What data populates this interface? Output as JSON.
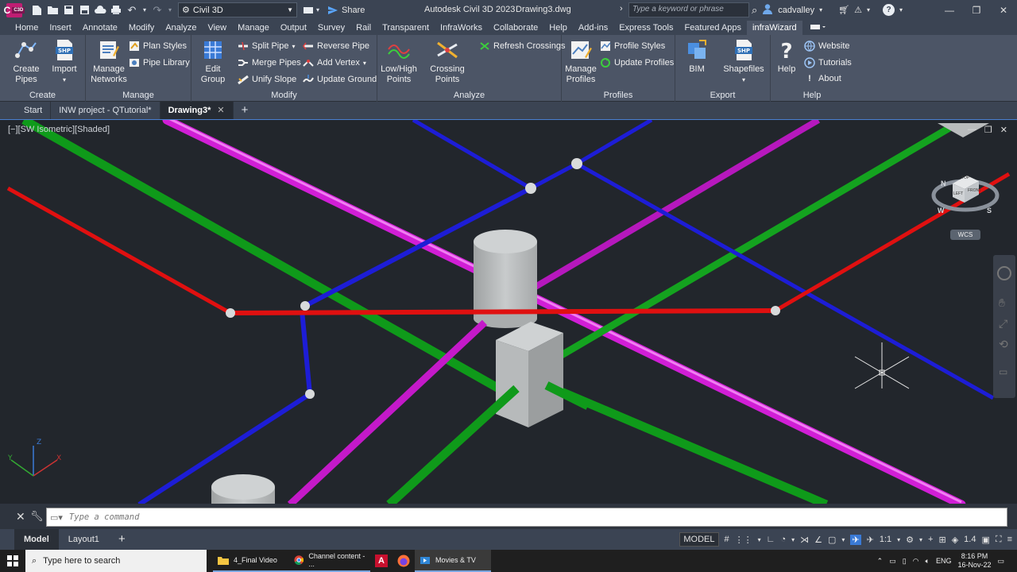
{
  "titlebar": {
    "logo_text": "C",
    "logo_sub": "C3D",
    "workspace": "Civil 3D",
    "share_label": "Share",
    "app_title": "Autodesk Civil 3D 2023",
    "document": "Drawing3.dwg",
    "search_placeholder": "Type a keyword or phrase",
    "user": "cadvalley"
  },
  "ribbon_tabs": [
    "Home",
    "Insert",
    "Annotate",
    "Modify",
    "Analyze",
    "View",
    "Manage",
    "Output",
    "Survey",
    "Rail",
    "Transparent",
    "InfraWorks",
    "Collaborate",
    "Help",
    "Add-ins",
    "Express Tools",
    "Featured Apps",
    "infraWizard"
  ],
  "ribbon": {
    "create": {
      "title": "Create",
      "create_pipes": "Create\nPipes",
      "import": "Import"
    },
    "manage": {
      "title": "Manage",
      "manage_networks": "Manage\nNetworks",
      "plan_styles": "Plan Styles",
      "pipe_library": "Pipe Library"
    },
    "modify": {
      "title": "Modify",
      "edit_group": "Edit Group",
      "split_pipe": "Split Pipe",
      "merge_pipes": "Merge Pipes",
      "unify_slope": "Unify Slope",
      "reverse_pipe": "Reverse Pipe",
      "add_vertex": "Add Vertex",
      "update_ground": "Update Ground"
    },
    "analyze": {
      "title": "Analyze",
      "low_high": "Low/High\nPoints",
      "crossing_points": "Crossing Points",
      "refresh_crossings": "Refresh Crossings"
    },
    "profiles": {
      "title": "Profiles",
      "manage_profiles": "Manage\nProfiles",
      "profile_styles": "Profile Styles",
      "update_profiles": "Update Profiles"
    },
    "export": {
      "title": "Export",
      "bim": "BIM",
      "shapefiles": "Shapefiles"
    },
    "help": {
      "title": "Help",
      "help": "Help",
      "website": "Website",
      "tutorials": "Tutorials",
      "about": "About"
    }
  },
  "file_tabs": [
    "Start",
    "INW project - QTutorial*",
    "Drawing3*"
  ],
  "viewport": {
    "label": "[−][SW Isometric][Shaded]",
    "viewcube_top": "TOP",
    "viewcube_left": "LEFT",
    "viewcube_front": "FRONT",
    "compass_w": "W",
    "compass_s": "S",
    "compass_n": "N",
    "wcs": "WCS"
  },
  "command": {
    "placeholder": "Type a command"
  },
  "status": {
    "tabs": [
      "Model",
      "Layout1"
    ],
    "model_label": "MODEL",
    "scale": "1:1",
    "number": "1.4"
  },
  "taskbar": {
    "search_placeholder": "Type here to search",
    "items": [
      "4_Final Video",
      "Channel content - ...",
      "Movies & TV"
    ],
    "lang": "ENG",
    "time": "8:16 PM",
    "date": "16-Nov-22"
  },
  "colors": {
    "green_pipe": "#0f9a1a",
    "magenta_pipe": "#d11ed6",
    "blue_pipe": "#1d1dd6",
    "red_pipe": "#e01010",
    "structure": "#b9bcbd"
  }
}
